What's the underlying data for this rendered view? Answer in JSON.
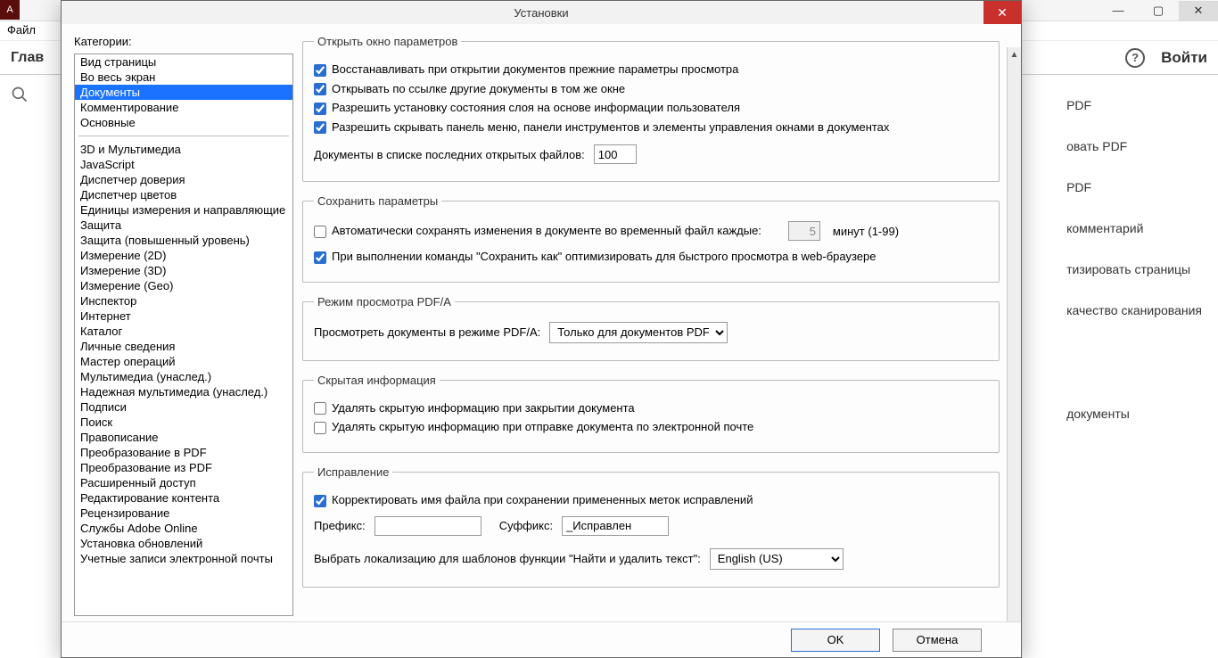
{
  "bg": {
    "file_menu": "Файл",
    "toolbar_left": "Глав",
    "login": "Войти",
    "right_items": [
      "PDF",
      "овать PDF",
      "PDF",
      "комментарий",
      "тизировать страницы",
      "качество сканирования",
      "документы"
    ]
  },
  "dialog": {
    "title": "Установки",
    "categories_label": "Категории:",
    "categories_group1": [
      "Вид страницы",
      "Во весь экран",
      "Документы",
      "Комментирование",
      "Основные"
    ],
    "categories_group2": [
      "3D и Мультимедиа",
      "JavaScript",
      "Диспетчер доверия",
      "Диспетчер цветов",
      "Единицы измерения и направляющие",
      "Защита",
      "Защита (повышенный уровень)",
      "Измерение (2D)",
      "Измерение (3D)",
      "Измерение (Geo)",
      "Инспектор",
      "Интернет",
      "Каталог",
      "Личные сведения",
      "Мастер операций",
      "Мультимедиа (унаслед.)",
      "Надежная мультимедиа (унаслед.)",
      "Подписи",
      "Поиск",
      "Правописание",
      "Преобразование в PDF",
      "Преобразование из PDF",
      "Расширенный доступ",
      "Редактирование контента",
      "Рецензирование",
      "Службы Adobe Online",
      "Установка обновлений",
      "Учетные записи электронной почты"
    ],
    "selected_category": "Документы",
    "open": {
      "legend": "Открыть окно параметров",
      "c1": "Восстанавливать при открытии документов прежние параметры просмотра",
      "c2": "Открывать по ссылке другие документы в том же окне",
      "c3": "Разрешить установку состояния слоя на основе информации пользователя",
      "c4": "Разрешить скрывать панель меню, панели инструментов и элементы управления окнами в документах",
      "recent_label": "Документы в списке последних открытых файлов:",
      "recent_value": "100"
    },
    "save": {
      "legend": "Сохранить параметры",
      "c1": "Автоматически сохранять изменения в документе во временный файл каждые:",
      "minutes_value": "5",
      "minutes_suffix": "минут (1-99)",
      "c2": "При выполнении команды \"Сохранить как\" оптимизировать для быстрого просмотра в web-браузере"
    },
    "pdfa": {
      "legend": "Режим просмотра PDF/A",
      "label": "Просмотреть документы в режиме PDF/A:",
      "value": "Только для документов PDF/A"
    },
    "hidden": {
      "legend": "Скрытая информация",
      "c1": "Удалять скрытую информацию при закрытии документа",
      "c2": "Удалять скрытую информацию при отправке документа по электронной почте"
    },
    "redact": {
      "legend": "Исправление",
      "c1": "Корректировать имя файла при сохранении примененных меток исправлений",
      "prefix_label": "Префикс:",
      "prefix_value": "",
      "suffix_label": "Суффикс:",
      "suffix_value": "_Исправлен",
      "locale_label": "Выбрать локализацию для шаблонов функции \"Найти и удалить текст\":",
      "locale_value": "English (US)"
    },
    "ok": "OK",
    "cancel": "Отмена"
  }
}
